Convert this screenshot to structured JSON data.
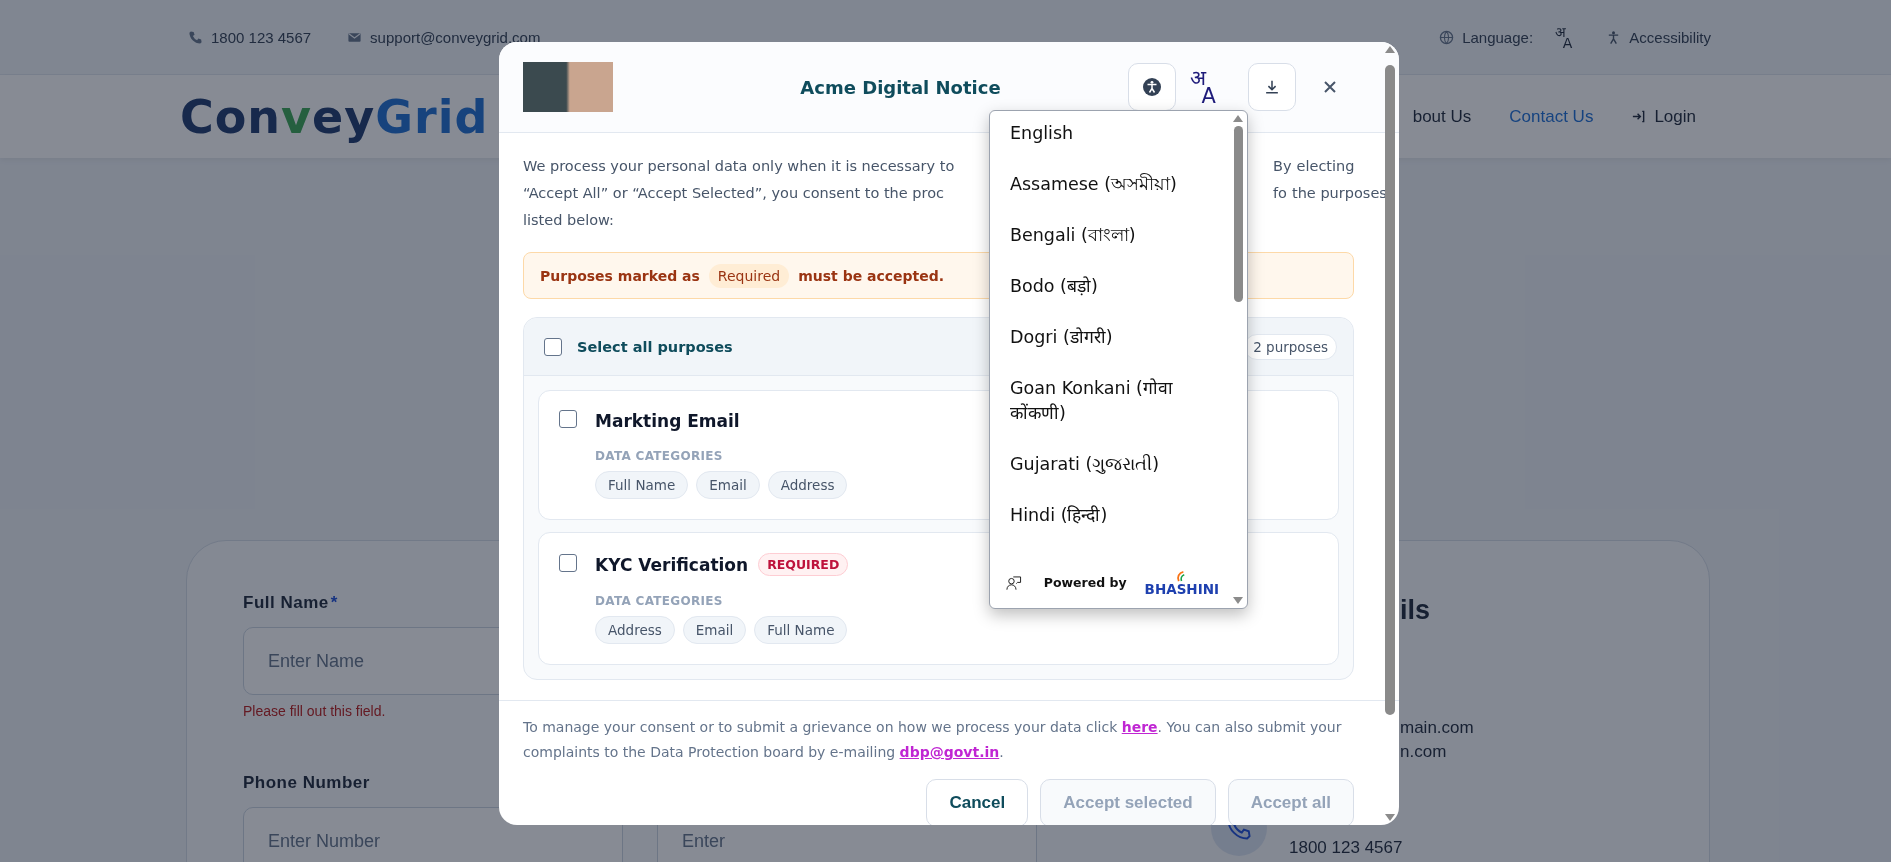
{
  "topbar": {
    "phone": "1800 123 4567",
    "email": "support@conveygrid.com",
    "language_label": "Language:",
    "language_glyph": {
      "top": "अ",
      "bottom": "A"
    },
    "accessibility": "Accessibility"
  },
  "header": {
    "logo": [
      "Con",
      "v",
      "ey",
      "Grid"
    ],
    "nav": [
      {
        "label": "bout Us",
        "selected": false
      },
      {
        "label": "Contact Us",
        "selected": true
      }
    ],
    "login": "Login"
  },
  "form": {
    "fields": [
      {
        "label": "Full Name",
        "mark": "*",
        "placeholder": "Enter Name",
        "error": "Please fill out this field."
      },
      {
        "label": "Phone Number",
        "placeholder": "Enter Number"
      }
    ],
    "field_3": {
      "placeholder": "Enter"
    },
    "details": {
      "heading": "ils",
      "lines": [
        "main.com",
        "n.com"
      ],
      "phone": "1800 123 4567"
    }
  },
  "modal": {
    "title": "Acme Digital Notice",
    "translate_glyph": {
      "top": "अ",
      "bottom": "A"
    },
    "intro_lines": [
      {
        "left": "We process your personal data only when it is necessary to",
        "right": [
          "By",
          "electing"
        ]
      },
      {
        "left": "“Accept All” or “Accept Selected”, you consent to the proc",
        "right": [
          "fo",
          "the purposes"
        ]
      },
      {
        "left": "listed below:"
      }
    ],
    "notice": {
      "before": "Purposes marked as",
      "tag": "Required",
      "after": "must be accepted."
    },
    "select_all": {
      "label": "Select all purposes",
      "checked": false
    },
    "count": "2 purposes",
    "purposes": [
      {
        "title": "Markting Email",
        "checked": false,
        "categories_label": "DATA CATEGORIES",
        "categories": [
          "Full Name",
          "Email",
          "Address"
        ]
      },
      {
        "title": "KYC Verification",
        "checked": false,
        "tag": "REQUIRED",
        "categories_label": "DATA CATEGORIES",
        "categories": [
          "Address",
          "Email",
          "Full Name"
        ]
      }
    ],
    "footer_text": [
      {
        "kind": "text",
        "text": "To manage your consent or to submit a grievance on how we process your data click "
      },
      {
        "kind": "link",
        "text": "here"
      },
      {
        "kind": "text",
        "text": ". You can also submit your complaints to the Data Protection board by e-mailing "
      },
      {
        "kind": "link",
        "text": "dbp@govt.in"
      },
      {
        "kind": "text",
        "text": "."
      }
    ],
    "buttons": [
      {
        "label": "Cancel",
        "disabled": false
      },
      {
        "label": "Accept selected",
        "disabled": true
      },
      {
        "label": "Accept all",
        "disabled": true
      }
    ]
  },
  "language_menu": {
    "options": [
      "English",
      "Assamese (অসমীয়া)",
      "Bengali (বাংলা)",
      "Bodo (बड़ो)",
      "Dogri (डोगरी)",
      "Goan Konkani (गोवा कोंकणी)",
      "Gujarati (ગુજરાતી)",
      "Hindi (हिन्दी)"
    ],
    "powered_by": "Powered by",
    "brand": "BHASHINI"
  }
}
